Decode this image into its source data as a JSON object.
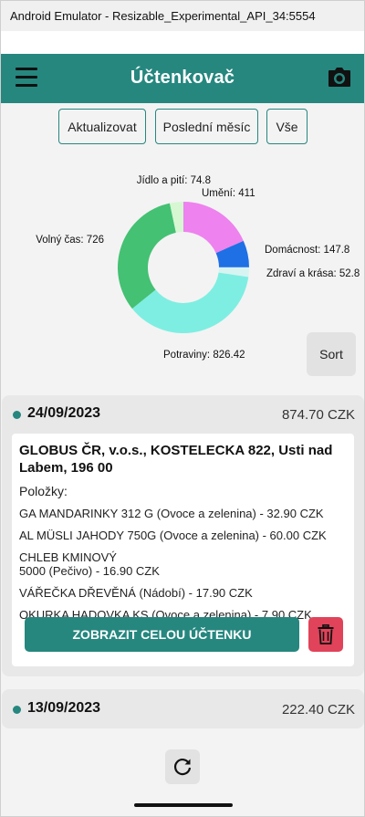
{
  "window": {
    "title": "Android Emulator - Resizable_Experimental_API_34:5554"
  },
  "app": {
    "title": "Účtenkovač",
    "accent": "#26877f",
    "menu_icon": "hamburger-menu-icon",
    "camera_icon": "camera-icon"
  },
  "filters": [
    "Aktualizovat",
    "Poslední měsíc",
    "Vše"
  ],
  "sort_label": "Sort",
  "chart_data": {
    "type": "pie",
    "donut": true,
    "labels": [
      "Umění",
      "Domácnost",
      "Zdraví a krása",
      "Potraviny",
      "Volný čas",
      "Jídlo a pití"
    ],
    "values": [
      411,
      147.8,
      52.8,
      826.42,
      726,
      74.8
    ],
    "display_labels": [
      "Umění: 411",
      "Domácnost: 147.8",
      "Zdraví a krása: 52.8",
      "Potraviny: 826.42",
      "Volný čas: 726",
      "Jídlo a pití: 74.8"
    ],
    "colors": [
      "#ee82ee",
      "#1f6fe5",
      "#d7f4f2",
      "#7eeee2",
      "#44c173",
      "#d6f7d2"
    ]
  },
  "receipts": [
    {
      "date": "24/09/2023",
      "total": "874.70 CZK",
      "store": "GLOBUS ČR, v.o.s., KOSTELECKA 822, Usti nad Labem, 196 00",
      "items_label": "Položky:",
      "items": [
        [
          "GA MANDARINKY 312 G (Ovoce a zelenina) - 32.90 CZK"
        ],
        [
          "AL MÜSLI JAHODY 750G (Ovoce a zelenina) - 60.00 CZK"
        ],
        [
          "CHLEB KMINOVÝ",
          "5000 (Pečivo) - 16.90 CZK"
        ],
        [
          "VÁŘEČKA DŘEVĚNÁ (Nádobí) - 17.90 CZK"
        ],
        [
          "OKURKA HADOVKA KS (Ovoce a zelenina) - 7.90 CZK"
        ]
      ],
      "show_button": "ZOBRAZIT CELOU ÚČTENKU",
      "delete_icon": "trash-icon",
      "delete_color": "#e0435a"
    },
    {
      "date": "13/09/2023",
      "total": "222.40 CZK"
    }
  ],
  "refresh_icon": "refresh-icon"
}
